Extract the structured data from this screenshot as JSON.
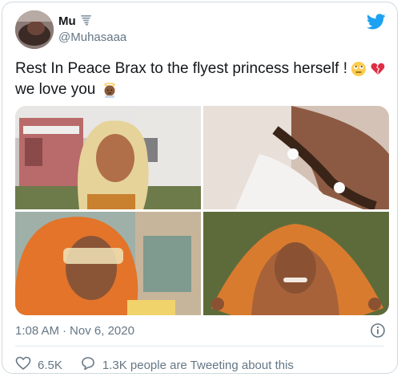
{
  "tweet": {
    "author": {
      "display_name": "Mu",
      "handle": "@Muhasaaa",
      "name_emoji": "tornado-icon"
    },
    "text_line1": "Rest In Peace Brax to the flyest princess herself !",
    "text_line2": "we love you",
    "emojis": [
      "face-with-rolling-eyes-icon",
      "broken-heart-icon",
      "baby-angel-icon"
    ],
    "time": "1:08 AM",
    "separator": "·",
    "date": "Nov 6, 2020",
    "likes": "6.5K",
    "conversation": "1.3K people are Tweeting about this"
  },
  "media": {
    "photos": [
      "photo-1",
      "photo-2",
      "photo-3",
      "photo-4"
    ]
  },
  "colors": {
    "brand": "#1da1f2",
    "text": "#14171a",
    "secondary": "#657786",
    "border": "#cfd9de"
  },
  "icons": [
    "twitter-bird-icon",
    "info-icon",
    "heart-icon",
    "speech-bubble-icon"
  ]
}
